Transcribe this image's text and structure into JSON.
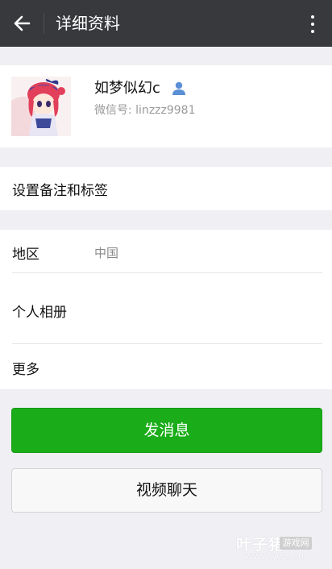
{
  "header": {
    "title": "详细资料"
  },
  "profile": {
    "name": "如梦似幻c",
    "wechat_id": "微信号: linzzz9981"
  },
  "remark": {
    "label": "设置备注和标签"
  },
  "info": {
    "region_label": "地区",
    "region_value": "中国",
    "album_label": "个人相册",
    "more_label": "更多"
  },
  "actions": {
    "send_message": "发消息",
    "video_call": "视频聊天"
  },
  "watermark": {
    "site": "叶子猪",
    "badge": "游戏网",
    "url": "www.yzz.cn"
  },
  "colors": {
    "header_bg": "#37393d",
    "primary_green": "#1aad19",
    "page_bg": "#efeff4"
  },
  "icons": [
    "back-arrow-icon",
    "more-vertical-icon",
    "person-icon"
  ]
}
